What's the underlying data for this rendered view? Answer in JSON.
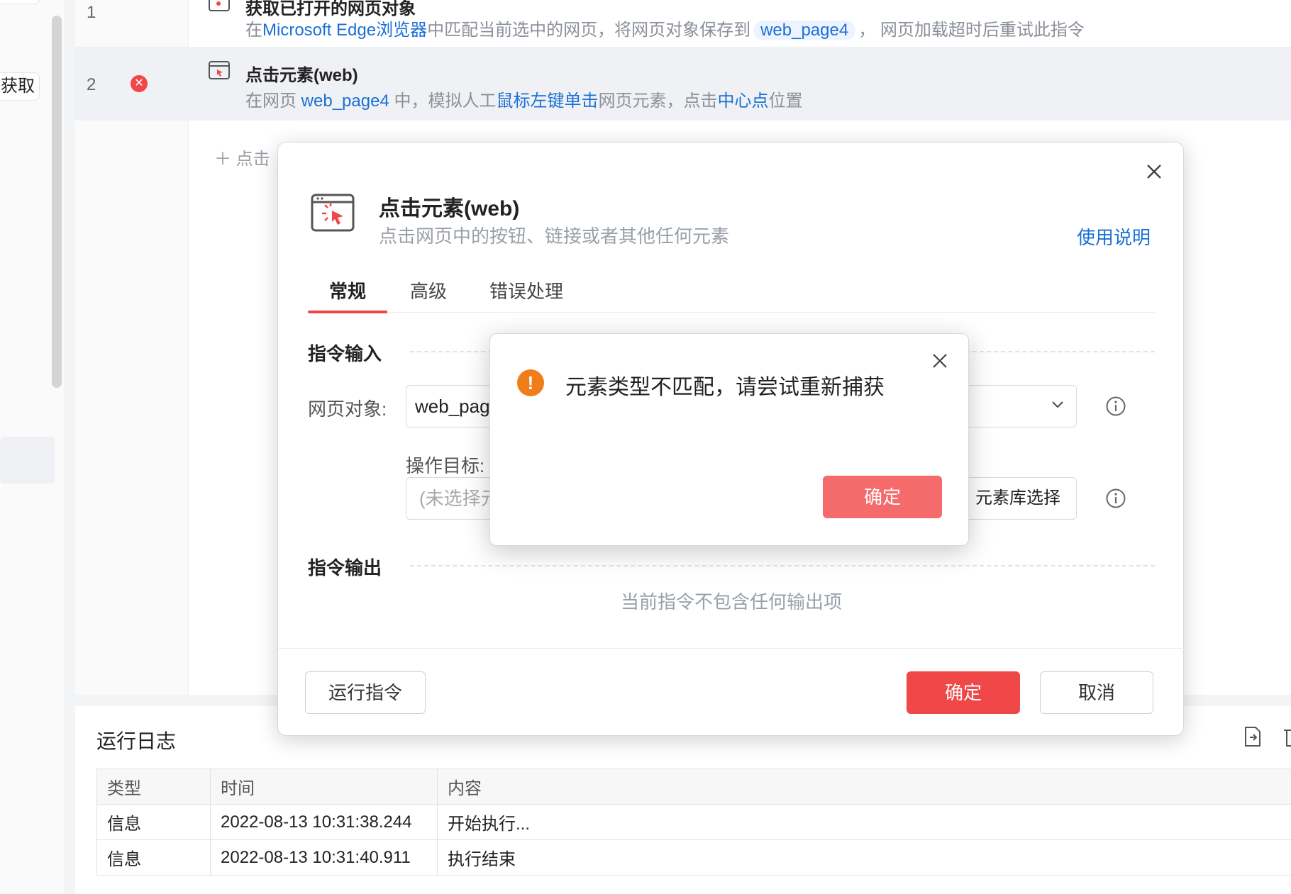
{
  "sidebar": {
    "pill_label": "获取"
  },
  "flow": {
    "rows": [
      {
        "num": "1",
        "title": "获取已打开的网页对象",
        "desc_prefix": "在",
        "desc_browser": "Microsoft Edge浏览器",
        "desc_mid": "中匹配当前选中的网页，将网页对象保存到",
        "desc_var": "web_page4",
        "desc_suffix": "， 网页加载超时后重试此指令"
      },
      {
        "num": "2",
        "title": "点击元素(web)",
        "desc_prefix": "在网页",
        "desc_var": "web_page4",
        "desc_mid": "中，模拟人工",
        "desc_action": "鼠标左键单击",
        "desc_mid2": "网页元素，点击",
        "desc_pos": "中心点",
        "desc_suffix": "位置"
      }
    ],
    "add_label": "点击"
  },
  "log": {
    "title": "运行日志",
    "columns": [
      "类型",
      "时间",
      "内容"
    ],
    "rows": [
      [
        "信息",
        "2022-08-13 10:31:38.244",
        "开始执行..."
      ],
      [
        "信息",
        "2022-08-13 10:31:40.911",
        "执行结束"
      ]
    ]
  },
  "dialog": {
    "title": "点击元素(web)",
    "subtitle": "点击网页中的按钮、链接或者其他任何元素",
    "help_link": "使用说明",
    "tabs": [
      "常规",
      "高级",
      "错误处理"
    ],
    "input_section": "指令输入",
    "web_object_label": "网页对象:",
    "web_object_value": "web_pag",
    "target_label": "操作目标:",
    "target_placeholder": "(未选择元",
    "library_button": "元素库选择",
    "output_section": "指令输出",
    "no_output": "当前指令不包含任何输出项",
    "run_button": "运行指令",
    "ok_button": "确定",
    "cancel_button": "取消"
  },
  "alert": {
    "message": "元素类型不匹配，请尝试重新捕获",
    "ok_button": "确定"
  },
  "colors": {
    "accent": "#f04848",
    "link": "#1a6fd6",
    "warning": "#f07d1a"
  }
}
